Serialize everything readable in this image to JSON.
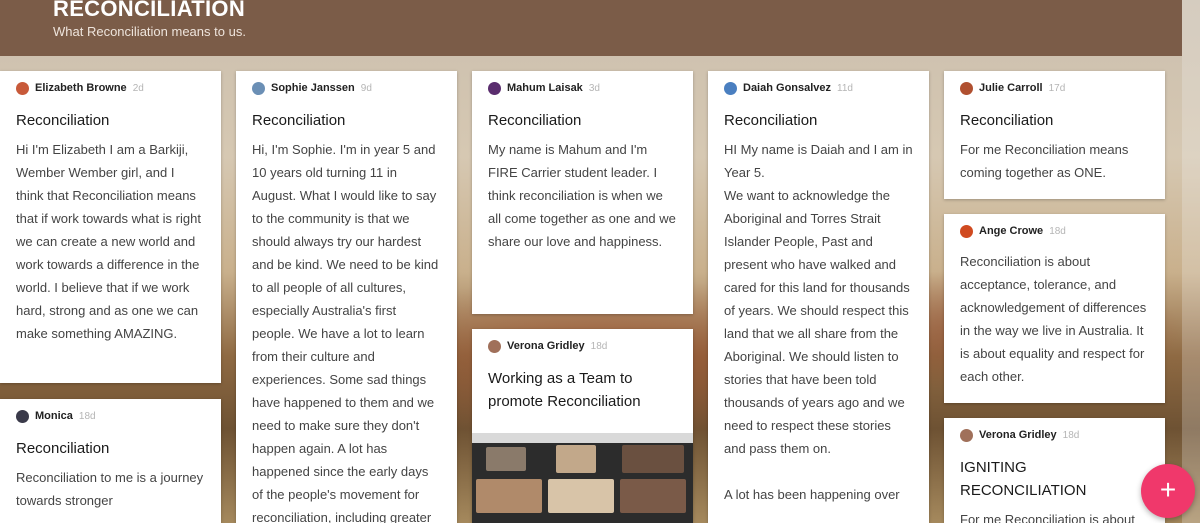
{
  "header": {
    "title": "RECONCILIATION",
    "subtitle": "What Reconciliation means to us."
  },
  "colors": {
    "header_bg": "#7b5c48",
    "fab": "#f0386b"
  },
  "posts": [
    {
      "author": "Elizabeth Browne",
      "age": "2d",
      "avatar_color": "#c85a3a",
      "title": "Reconciliation",
      "body": "Hi I'm Elizabeth I am a Barkiji, Wember Wember girl, and I think that Reconciliation means that if work towards what is right we can create a new world and work towards a difference in the world. I believe that if we work hard, strong and as one we can make something AMAZING."
    },
    {
      "author": "Monica",
      "age": "18d",
      "avatar_color": "#3a3a4a",
      "title": "Reconciliation",
      "body": "Reconciliation to me is a journey towards stronger"
    },
    {
      "author": "Sophie Janssen",
      "age": "9d",
      "avatar_color": "#6b8fb5",
      "title": "Reconciliation",
      "body": "Hi, I'm Sophie. I'm in year 5 and 10 years old turning 11 in August. What I would like to say to the community is that we should always try our hardest and be kind. We need to be kind to all people of all cultures, especially Australia's first people. We have a lot to learn from their culture and experiences. Some sad things have happened to them and we need to make sure they don't happen again. A lot has happened since the early days of the people's movement for reconciliation, including greater"
    },
    {
      "author": "Mahum Laisak",
      "age": "3d",
      "avatar_color": "#5a2d6e",
      "title": "Reconciliation",
      "body": "My name is Mahum and I'm FIRE Carrier student leader. I think reconciliation is when we all come together as one and we share our love and happiness."
    },
    {
      "author": "Verona Gridley",
      "age": "18d",
      "avatar_color": "#a0705a",
      "title": "Working as a Team to promote Reconciliation",
      "body": ""
    },
    {
      "author": "Daiah Gonsalvez",
      "age": "11d",
      "avatar_color": "#4a7fc0",
      "title": "Reconciliation",
      "body": "HI My name is Daiah and I am in Year 5.\nWe want to acknowledge the Aboriginal and Torres Strait Islander People, Past and present who have walked and cared for this land for thousands of years. We should respect this land that we all share from the Aboriginal. We should listen to stories that have been told thousands of years ago and we need to respect these stories and pass them on.\n\nA lot has been happening over"
    },
    {
      "author": "Julie Carroll",
      "age": "17d",
      "avatar_color": "#b05030",
      "title": "Reconciliation",
      "body": "For me Reconciliation means coming together as ONE."
    },
    {
      "author": "Ange Crowe",
      "age": "18d",
      "avatar_color": "#d04a20",
      "title": "",
      "body": "Reconciliation is about acceptance, tolerance, and acknowledgement of differences in the way we live in Australia. It is about equality and respect for each other."
    },
    {
      "author": "Verona Gridley",
      "age": "18d",
      "avatar_color": "#a0705a",
      "title": "IGNITING RECONCILIATION",
      "body": "For me Reconciliation is about"
    }
  ],
  "fab": {
    "label": "+"
  }
}
